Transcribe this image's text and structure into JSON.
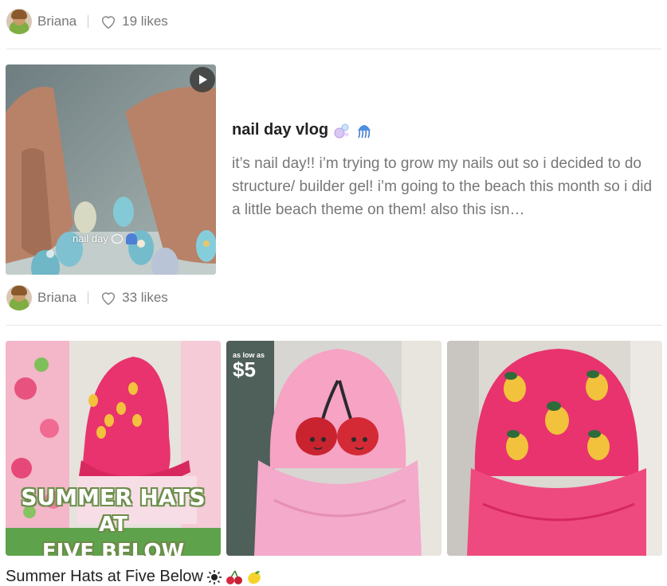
{
  "posts": [
    {
      "author": "Briana",
      "likes": "19 likes"
    },
    {
      "author": "Briana",
      "likes": "33 likes",
      "title": "nail day vlog",
      "title_emoji": [
        "bubbles-emoji",
        "jellyfish-emoji"
      ],
      "description": "it’s nail day!! i’m trying to grow my nails out so i decided to do structure/ builder gel! i’m going to the beach this month so i did a little beach theme on them! also this isn…",
      "thumbnail_caption": "nail day"
    },
    {
      "title": "Summer Hats at Five Below",
      "title_emoji": [
        "sun-emoji",
        "cherries-emoji",
        "lemon-emoji"
      ],
      "image_texts": {
        "overlay_line1": "SUMMER HATS",
        "overlay_line2": "AT",
        "overlay_line3": "FIVE BELOW",
        "price_top": "as low as",
        "price": "$5"
      }
    }
  ],
  "colors": {
    "pink_hat": "#e8336e",
    "light_pink_hat": "#f6a3c4",
    "text_muted": "#777777"
  }
}
